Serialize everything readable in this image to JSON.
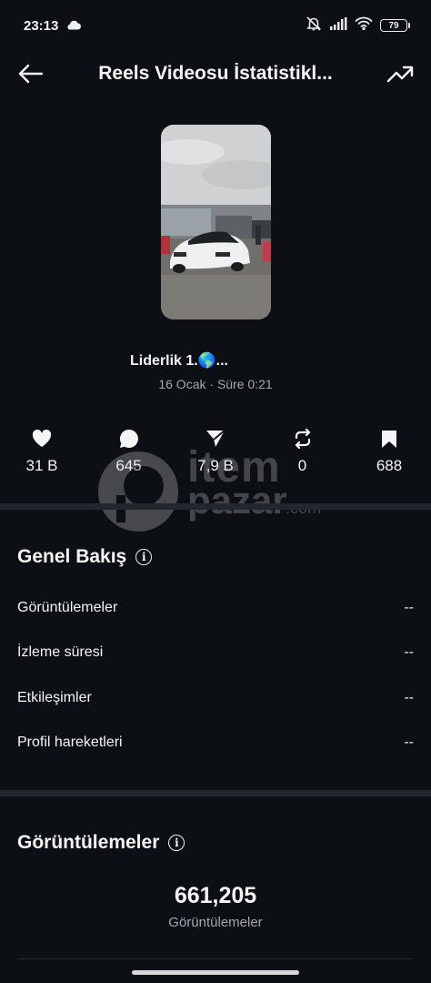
{
  "status_bar": {
    "time": "23:13",
    "cloud_icon": "cloud-icon",
    "battery": "79"
  },
  "app_bar": {
    "title": "Reels Videosu İstatistikl...",
    "back_icon": "arrow-left-icon",
    "insights_icon": "trending-up-icon"
  },
  "reel": {
    "name": "Liderlik 1.🌎...",
    "date": "16 Ocak",
    "separator": " · ",
    "duration": "Süre 0:21"
  },
  "stats": [
    {
      "icon": "heart-icon",
      "value": "31 B"
    },
    {
      "icon": "comment-icon",
      "value": "645"
    },
    {
      "icon": "send-icon",
      "value": "7,9 B"
    },
    {
      "icon": "repost-icon",
      "value": "0"
    },
    {
      "icon": "bookmark-icon",
      "value": "688"
    }
  ],
  "watermark": {
    "line1": "item",
    "line2": "pazar",
    "suffix": ".com"
  },
  "overview": {
    "title": "Genel Bakış",
    "info_icon": "i",
    "rows": [
      {
        "label": "Görüntülemeler",
        "value": "--"
      },
      {
        "label": "İzleme süresi",
        "value": "--"
      },
      {
        "label": "Etkileşimler",
        "value": "--"
      },
      {
        "label": "Profil hareketleri",
        "value": "--"
      }
    ]
  },
  "views": {
    "title": "Görüntülemeler",
    "info_icon": "i",
    "total": "661,205",
    "caption": "Görüntülemeler"
  },
  "colors": {
    "background": "#0c0f14",
    "divider": "#22262d",
    "muted_text": "#a4a8ae"
  }
}
